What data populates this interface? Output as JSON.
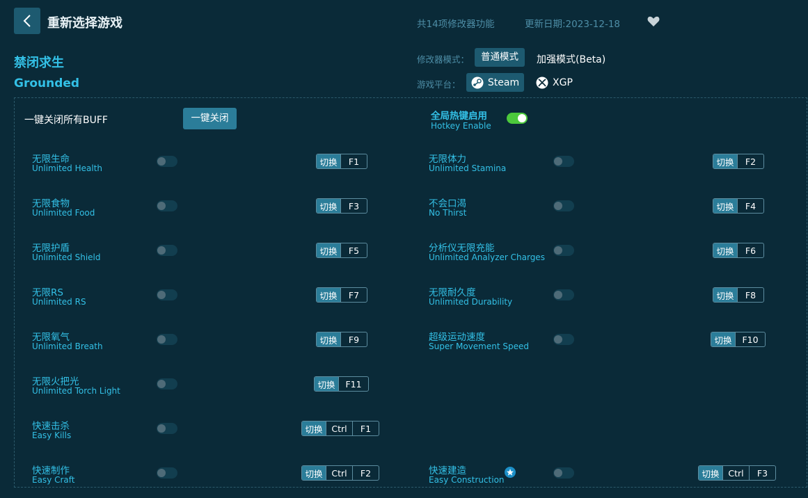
{
  "header": {
    "back_icon": "chevron-left-icon",
    "reselect_label": "重新选择游戏",
    "feature_count": "共14项修改器功能",
    "update_date": "更新日期:2023-12-18",
    "favorite_icon": "heart-icon"
  },
  "game": {
    "name_cn": "禁闭求生",
    "name_en": "Grounded"
  },
  "mode": {
    "label": "修改器模式：",
    "normal": "普通模式",
    "enhanced": "加强模式(Beta)",
    "selected": "普通模式"
  },
  "platform": {
    "label": "游戏平台：",
    "steam": "Steam",
    "xgp": "XGP",
    "selected": "Steam"
  },
  "controls": {
    "kill_all_label": "一键关闭所有BUFF",
    "kill_all_button": "一键关闭",
    "hotkey_cn": "全局热键启用",
    "hotkey_en": "Hotkey Enable",
    "hotkey_enabled": true
  },
  "switch_label": "切换",
  "features": [
    {
      "cn": "无限生命",
      "en": "Unlimited Health",
      "keys": [
        "F1"
      ],
      "enabled": false
    },
    {
      "cn": "无限体力",
      "en": "Unlimited Stamina",
      "keys": [
        "F2"
      ],
      "enabled": false
    },
    {
      "cn": "无限食物",
      "en": "Unlimited Food",
      "keys": [
        "F3"
      ],
      "enabled": false
    },
    {
      "cn": "不会口渴",
      "en": "No Thirst",
      "keys": [
        "F4"
      ],
      "enabled": false
    },
    {
      "cn": "无限护盾",
      "en": "Unlimited Shield",
      "keys": [
        "F5"
      ],
      "enabled": false
    },
    {
      "cn": "分析仪无限充能",
      "en": "Unlimited Analyzer Charges",
      "keys": [
        "F6"
      ],
      "enabled": false
    },
    {
      "cn": "无限RS",
      "en": "Unlimited RS",
      "keys": [
        "F7"
      ],
      "enabled": false
    },
    {
      "cn": "无限耐久度",
      "en": "Unlimited Durability",
      "keys": [
        "F8"
      ],
      "enabled": false
    },
    {
      "cn": "无限氧气",
      "en": "Unlimited Breath",
      "keys": [
        "F9"
      ],
      "enabled": false
    },
    {
      "cn": "超级运动速度",
      "en": "Super Movement Speed",
      "keys": [
        "F10"
      ],
      "enabled": false
    },
    {
      "cn": "无限火把光",
      "en": "Unlimited Torch Light",
      "keys": [
        "F11"
      ],
      "enabled": false
    },
    {
      "cn": "快速击杀",
      "en": "Easy Kills",
      "keys": [
        "Ctrl",
        "F1"
      ],
      "enabled": false
    },
    {
      "cn": "快速制作",
      "en": "Easy Craft",
      "keys": [
        "Ctrl",
        "F2"
      ],
      "enabled": false
    },
    {
      "cn": "快速建造",
      "en": "Easy Construction",
      "keys": [
        "Ctrl",
        "F3"
      ],
      "enabled": false,
      "badge_icon": "star-badge-icon"
    }
  ],
  "colors": {
    "background": "#0a2a38",
    "accent": "#33c0e6",
    "button": "#1d5a70",
    "switch_on": "#4cc93c"
  }
}
